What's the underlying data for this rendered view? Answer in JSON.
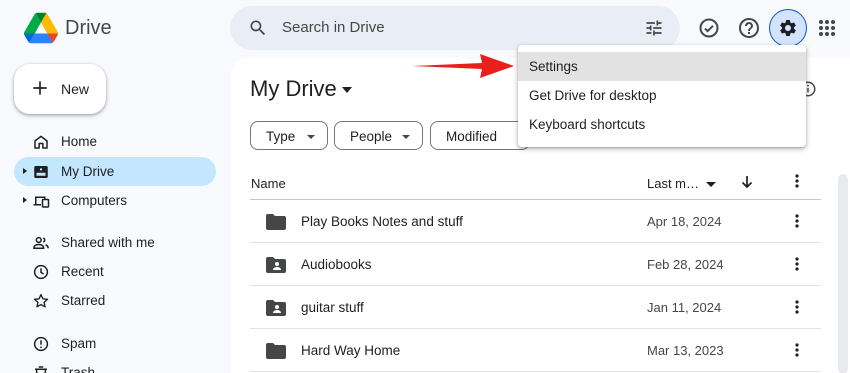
{
  "app": {
    "name": "Drive"
  },
  "search": {
    "placeholder": "Search in Drive"
  },
  "sidebar": {
    "new_label": "New",
    "items": [
      {
        "label": "Home",
        "icon": "home-icon"
      },
      {
        "label": "My Drive",
        "icon": "my-drive-icon",
        "active": true
      },
      {
        "label": "Computers",
        "icon": "computers-icon"
      },
      {
        "label": "Shared with me",
        "icon": "shared-icon"
      },
      {
        "label": "Recent",
        "icon": "clock-icon"
      },
      {
        "label": "Starred",
        "icon": "star-icon"
      },
      {
        "label": "Spam",
        "icon": "spam-icon"
      },
      {
        "label": "Trash",
        "icon": "trash-icon"
      }
    ]
  },
  "main": {
    "title": "My Drive",
    "filters": [
      "Type",
      "People",
      "Modified"
    ],
    "columns": {
      "name": "Name",
      "modified": "Last m…"
    },
    "files": [
      {
        "name": "Play Books Notes and stuff",
        "date": "Apr 18, 2024",
        "shared": false
      },
      {
        "name": "Audiobooks",
        "date": "Feb 28, 2024",
        "shared": true
      },
      {
        "name": "guitar stuff",
        "date": "Jan 11, 2024",
        "shared": true
      },
      {
        "name": "Hard Way Home",
        "date": "Mar 13, 2023",
        "shared": false
      }
    ]
  },
  "settings_menu": {
    "items": [
      "Settings",
      "Get Drive for desktop",
      "Keyboard shortcuts"
    ]
  },
  "colors": {
    "accent": "#0b57d0",
    "active_nav": "#c2e7ff",
    "annotation_arrow": "#e8201c"
  }
}
